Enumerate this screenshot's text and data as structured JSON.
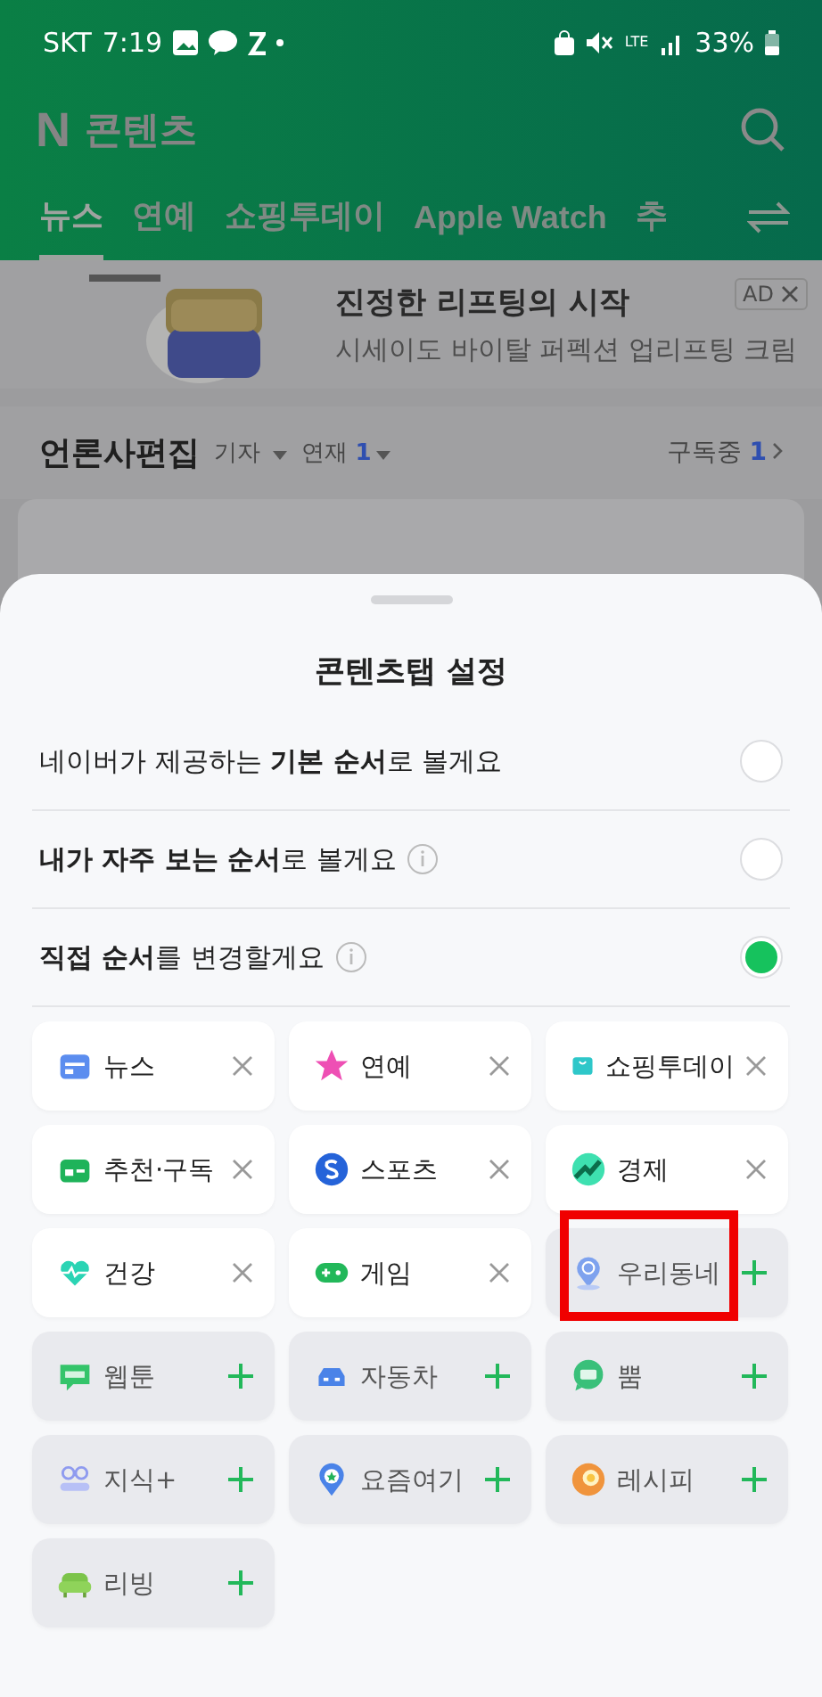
{
  "status_bar": {
    "carrier": "SKT",
    "time": "7:19",
    "network": "LTE",
    "battery": "33%"
  },
  "header": {
    "logo": "N",
    "title": "콘텐츠"
  },
  "tabs": [
    {
      "label": "뉴스",
      "selected": true
    },
    {
      "label": "연예",
      "selected": false
    },
    {
      "label": "쇼핑투데이",
      "selected": false
    },
    {
      "label": "Apple Watch",
      "selected": false
    },
    {
      "label": "추",
      "selected": false
    }
  ],
  "ad": {
    "headline": "진정한 리프팅의 시작",
    "subline": "시세이도 바이탈 퍼펙션 업리프팅 크림",
    "badge": "AD"
  },
  "section": {
    "title": "언론사편집",
    "filters": [
      {
        "label": "기자"
      },
      {
        "label": "연재",
        "count": "1"
      }
    ],
    "subscribed": {
      "label": "구독중",
      "count": "1"
    }
  },
  "sheet": {
    "title": "콘텐츠탭 설정",
    "options": [
      {
        "text": "네이버가 제공하는 **기본 순서**로 볼게요",
        "info": false,
        "selected": false
      },
      {
        "text": "**내가 자주 보는 순서**로 볼게요",
        "info": true,
        "selected": false
      },
      {
        "text": "**직접 순서**를 변경할게요",
        "info": true,
        "selected": true
      }
    ],
    "tiles": [
      {
        "label": "뉴스",
        "added": true,
        "highlighted": false
      },
      {
        "label": "연예",
        "added": true,
        "highlighted": false
      },
      {
        "label": "쇼핑투데이",
        "added": true,
        "highlighted": false
      },
      {
        "label": "추천·구독",
        "added": true,
        "highlighted": false
      },
      {
        "label": "스포츠",
        "added": true,
        "highlighted": false
      },
      {
        "label": "경제",
        "added": true,
        "highlighted": false
      },
      {
        "label": "건강",
        "added": true,
        "highlighted": false
      },
      {
        "label": "게임",
        "added": true,
        "highlighted": false
      },
      {
        "label": "우리동네",
        "added": false,
        "highlighted": true
      },
      {
        "label": "웹툰",
        "added": false,
        "highlighted": false
      },
      {
        "label": "자동차",
        "added": false,
        "highlighted": false
      },
      {
        "label": "뿜",
        "added": false,
        "highlighted": false
      },
      {
        "label": "지식+",
        "added": false,
        "highlighted": false
      },
      {
        "label": "요즘여기",
        "added": false,
        "highlighted": false
      },
      {
        "label": "레시피",
        "added": false,
        "highlighted": false
      },
      {
        "label": "리빙",
        "added": false,
        "highlighted": false
      }
    ]
  }
}
